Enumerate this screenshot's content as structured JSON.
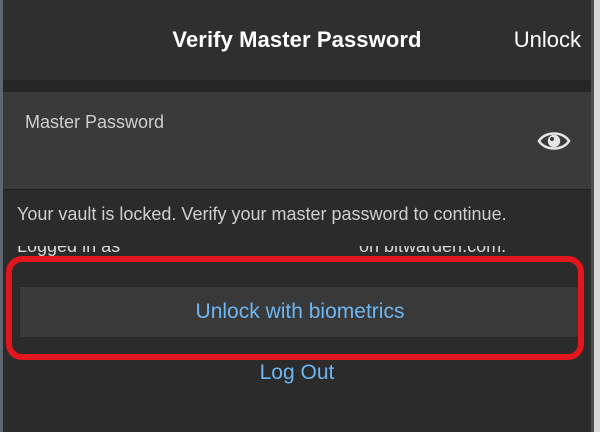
{
  "header": {
    "title": "Verify Master Password",
    "unlock_label": "Unlock"
  },
  "form": {
    "master_password_label": "Master Password",
    "toggle_visibility_icon": "eye-icon"
  },
  "message": {
    "info": "Your vault is locked. Verify your master password to continue.",
    "logged_in_as_prefix": "Logged in as",
    "logged_in_as_suffix": "on bitwarden.com."
  },
  "actions": {
    "biometrics_label": "Unlock with biometrics",
    "logout_label": "Log Out"
  },
  "colors": {
    "accent_link": "#6db6f2",
    "highlight_annotation": "#e4161d",
    "background": "#2b2b2b"
  }
}
